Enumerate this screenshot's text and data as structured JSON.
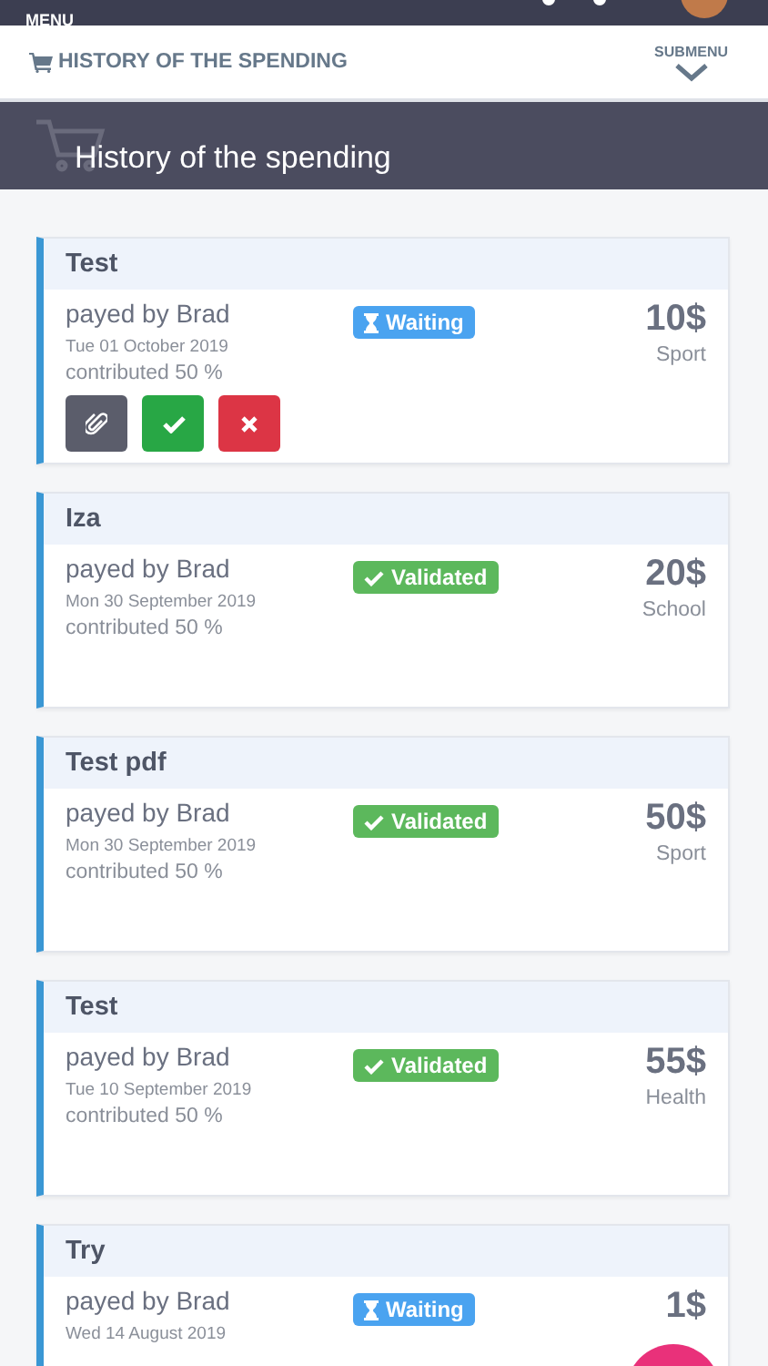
{
  "top_bar": {
    "menu_label": "MENU"
  },
  "header": {
    "title": "HISTORY OF THE SPENDING",
    "submenu_label": "SUBMENU"
  },
  "banner": {
    "title": "History of the spending"
  },
  "spendings": [
    {
      "title": "Test",
      "payer": "payed by Brad",
      "date": "Tue 01 October 2019",
      "share": "contributed 50 %",
      "status": {
        "kind": "waiting",
        "label": "Waiting"
      },
      "amount": "10$",
      "category": "Sport",
      "actions": [
        {
          "kind": "attach"
        },
        {
          "kind": "validate"
        },
        {
          "kind": "reject"
        }
      ]
    },
    {
      "title": "Iza",
      "payer": "payed by Brad",
      "date": "Mon 30 September 2019",
      "share": "contributed 50 %",
      "status": {
        "kind": "validated",
        "label": "Validated"
      },
      "amount": "20$",
      "category": "School"
    },
    {
      "title": "Test pdf",
      "payer": "payed by Brad",
      "date": "Mon 30 September 2019",
      "share": "contributed 50 %",
      "status": {
        "kind": "validated",
        "label": "Validated"
      },
      "amount": "50$",
      "category": "Sport"
    },
    {
      "title": "Test",
      "payer": "payed by Brad",
      "date": "Tue 10 September 2019",
      "share": "contributed 50 %",
      "status": {
        "kind": "validated",
        "label": "Validated"
      },
      "amount": "55$",
      "category": "Health"
    },
    {
      "title": "Try",
      "payer": "payed by Brad",
      "date": "Wed 14 August 2019",
      "status": {
        "kind": "waiting",
        "label": "Waiting"
      },
      "amount": "1$"
    }
  ]
}
